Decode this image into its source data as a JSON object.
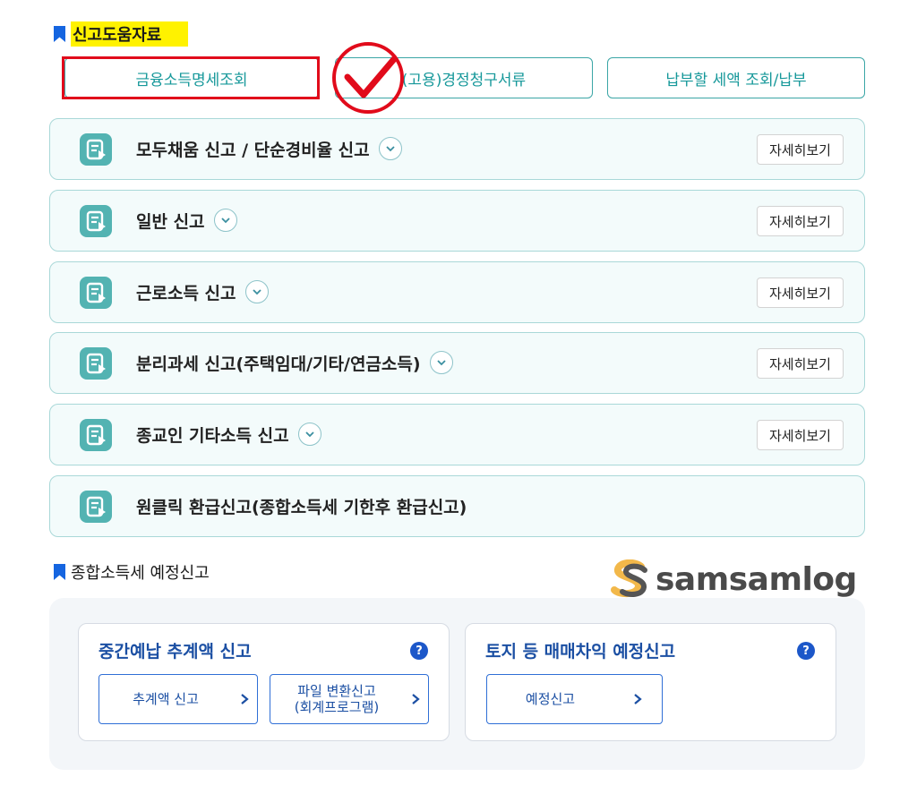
{
  "section1": {
    "title": "신고도움자료"
  },
  "top_buttons": [
    {
      "label": "금융소득명세조회"
    },
    {
      "label": "(고용)경정청구서류"
    },
    {
      "label": "납부할 세액 조회/납부"
    }
  ],
  "accordion": [
    {
      "label": "모두채움 신고 / 단순경비율 신고",
      "detail": "자세히보기"
    },
    {
      "label": "일반 신고",
      "detail": "자세히보기"
    },
    {
      "label": "근로소득 신고",
      "detail": "자세히보기"
    },
    {
      "label": "분리과세 신고(주택임대/기타/연금소득)",
      "detail": "자세히보기"
    },
    {
      "label": "종교인 기타소득 신고",
      "detail": "자세히보기"
    },
    {
      "label": "원클릭 환급신고(종합소득세 기한후 환급신고)"
    }
  ],
  "section2": {
    "title": "종합소득세 예정신고"
  },
  "watermark": {
    "text": "samsamlog"
  },
  "cards": [
    {
      "title": "중간예납 추계액 신고",
      "help": "?",
      "buttons": [
        {
          "line1": "추계액 신고"
        },
        {
          "line1": "파일 변환신고",
          "line2": "(회계프로그램)"
        }
      ]
    },
    {
      "title": "토지 등 매매차익 예정신고",
      "help": "?",
      "buttons": [
        {
          "line1": "예정신고"
        }
      ]
    }
  ],
  "colors": {
    "teal": "#3ba6a6",
    "blue": "#1b4fa3",
    "highlight": "#fff200",
    "annotation_red": "#e10b1b"
  }
}
